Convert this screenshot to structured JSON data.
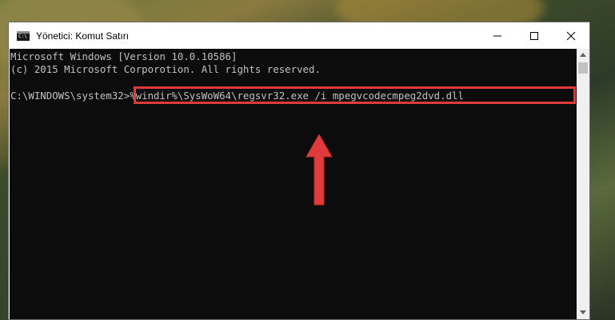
{
  "window": {
    "title": "Yönetici: Komut Satırı",
    "icon": "cmd-icon",
    "app_icon_glyph": "C:\\",
    "controls": [
      "minimize-icon",
      "maximize-icon",
      "close-icon"
    ]
  },
  "console": {
    "lines": [
      "Microsoft Windows [Version 10.0.10586]",
      "(c) 2015 Microsoft Corporotion. All rights reserved.",
      "",
      "C:\\WINDOWS\\system32>%windir%\\SysWoW64\\regsvr32.exe /i mpegvcodecmpeg2dvd.dll"
    ],
    "prompt": "C:\\WINDOWS\\system32>",
    "command": "%windir%\\SysWoW64\\regsvr32.exe /i mpegvcodecmpeg2dvd.dll"
  },
  "annotation": {
    "highlight_color": "#e03a3a",
    "arrow_color": "#e03a3a"
  }
}
